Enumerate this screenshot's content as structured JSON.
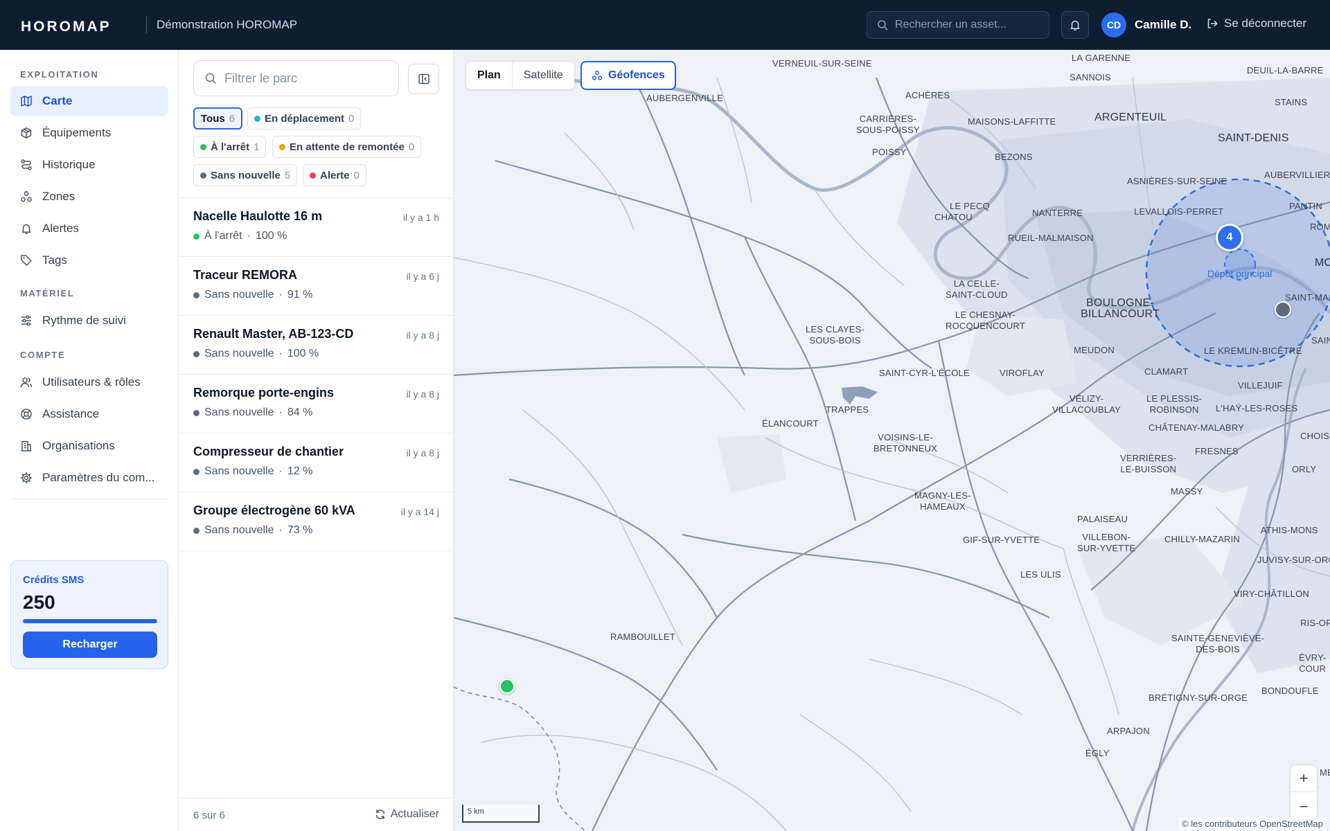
{
  "header": {
    "logo": "HOROMAP",
    "org_name": "Démonstration HOROMAP",
    "search_placeholder": "Rechercher un asset...",
    "user_initials": "CD",
    "user_name": "Camille D.",
    "logout_label": "Se déconnecter"
  },
  "sidebar": {
    "sections": [
      {
        "title": "EXPLOITATION"
      },
      {
        "title": "MATÉRIEL"
      },
      {
        "title": "COMPTE"
      }
    ],
    "items": [
      {
        "label": "Carte",
        "icon": "map-icon"
      },
      {
        "label": "Équipements",
        "icon": "box-icon"
      },
      {
        "label": "Historique",
        "icon": "route-icon"
      },
      {
        "label": "Zones",
        "icon": "zones-icon"
      },
      {
        "label": "Alertes",
        "icon": "bell-icon"
      },
      {
        "label": "Tags",
        "icon": "tag-icon"
      },
      {
        "label": "Rythme de suivi",
        "icon": "sliders-icon"
      },
      {
        "label": "Utilisateurs & rôles",
        "icon": "users-icon"
      },
      {
        "label": "Assistance",
        "icon": "lifebuoy-icon"
      },
      {
        "label": "Organisations",
        "icon": "building-icon"
      },
      {
        "label": "Paramètres du com...",
        "icon": "gear-icon"
      }
    ],
    "sms": {
      "title": "Crédits SMS",
      "value": "250",
      "fill_percent": 100,
      "button_label": "Recharger"
    }
  },
  "panel": {
    "filter_placeholder": "Filtrer le parc",
    "chips": [
      {
        "label": "Tous",
        "count": "6",
        "color": ""
      },
      {
        "label": "En déplacement",
        "count": "0",
        "color": "#22b5d6"
      },
      {
        "label": "À l'arrêt",
        "count": "1",
        "color": "#22c55e"
      },
      {
        "label": "En attente de remontée",
        "count": "0",
        "color": "#f59e0b"
      },
      {
        "label": "Sans nouvelle",
        "count": "5",
        "color": "#5f6b7d"
      },
      {
        "label": "Alerte",
        "count": "0",
        "color": "#ef4444"
      }
    ],
    "assets": [
      {
        "name": "Nacelle Haulotte 16 m",
        "time": "il y a 1 h",
        "status": "À l'arrêt",
        "battery": "100 %",
        "color": "#22c55e"
      },
      {
        "name": "Traceur REMORA",
        "time": "il y a 6 j",
        "status": "Sans nouvelle",
        "battery": "91 %",
        "color": "#5f6b7d"
      },
      {
        "name": "Renault Master, AB-123-CD",
        "time": "il y a 8 j",
        "status": "Sans nouvelle",
        "battery": "100 %",
        "color": "#5f6b7d"
      },
      {
        "name": "Remorque porte-engins",
        "time": "il y a 8 j",
        "status": "Sans nouvelle",
        "battery": "84 %",
        "color": "#5f6b7d"
      },
      {
        "name": "Compresseur de chantier",
        "time": "il y a 8 j",
        "status": "Sans nouvelle",
        "battery": "12 %",
        "color": "#5f6b7d"
      },
      {
        "name": "Groupe électrogène 60 kVA",
        "time": "il y a 14 j",
        "status": "Sans nouvelle",
        "battery": "73 %",
        "color": "#5f6b7d"
      }
    ],
    "separator": "·",
    "footer_count": "6 sur 6",
    "refresh_label": "Actualiser"
  },
  "map": {
    "modes": [
      "Plan",
      "Satellite"
    ],
    "geofence_label": "Géofences",
    "cluster_count": "4",
    "depot_label": "Dépôt principal",
    "scale_label": "5 km",
    "attribution": "© les contributeurs OpenStreetMap",
    "zoom_in": "+",
    "zoom_out": "−",
    "places": [
      "VERNEUIL-SUR-SEINE",
      "LA GARENNE",
      "DEUIL-LA-BARRE",
      "SANNOIS",
      "ACHÈRES",
      "AUBERGENVILLE",
      "CARRIÈRES-\nSOUS-POISSY",
      "MAISONS-LAFFITTE",
      "ARGENTEUIL",
      "STAINS",
      "SAINT-DENIS",
      "POISSY",
      "BEZONS",
      "AUBERVILLIERS",
      "ASNIÈRES-SUR-SEINE",
      "LE PECQ",
      "NANTERRE",
      "LEVALLOIS-PERRET",
      "PANTIN",
      "CHATOU",
      "RUEIL-MALMAISON",
      "ROM",
      "LA CELLE-\nSAINT-CLOUD",
      "BOULOGNE-\nBILLANCOURT",
      "LE CHESNAY-\nROCQUENCOURT",
      "MO",
      "SAINT-MA",
      "LES CLAYES-\nSOUS-BOIS",
      "MEUDON",
      "LE KREMLIN-BICÊTRE",
      "SAIN",
      "SAINT-CYR-L'ÉCOLE",
      "VIROFLAY",
      "CLAMART",
      "VILLEJUIF",
      "VÉLIZY-\nVILLACOUBLAY",
      "LE PLESSIS-\nROBINSON",
      "L'HAŸ-LES-ROSES",
      "TRAPPES",
      "ÉLANCOURT",
      "CHÂTENAY-MALABRY",
      "CHOISY-LE-",
      "VOISINS-LE-\nBRETONNEUX",
      "VERRIÈRES-\nLE-BUISSON",
      "FRESNES",
      "ORLY",
      "MAGNY-LES-\nHAMEAUX",
      "MASSY",
      "PALAISEAU",
      "GIF-SUR-YVETTE",
      "VILLEBON-\nSUR-YVETTE",
      "CHILLY-MAZARIN",
      "ATHIS-MONS",
      "JUVISY-SUR-ORGE",
      "LES ULIS",
      "VIRY-CHÂTILLON",
      "RIS-ORAN",
      "RAMBOUILLET",
      "SAINTE-GENEVIÈVE-\nDES-BOIS",
      "ÉVRY-\nCOUR",
      "BONDOUFLE",
      "BRÉTIGNY-SUR-ORGE",
      "ARPAJON",
      "ÉGLY",
      "ME"
    ]
  }
}
